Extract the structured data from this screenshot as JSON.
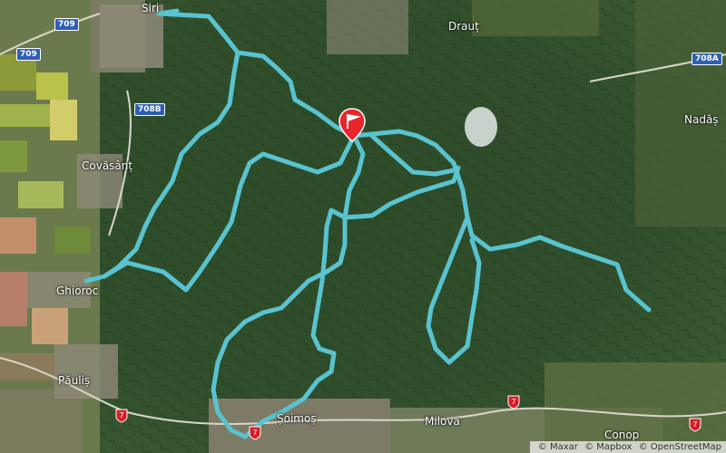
{
  "map": {
    "route_color": "#59c3cf",
    "marker_color": "#e8262b",
    "places": [
      {
        "id": "siria",
        "label": "Siri"
      },
      {
        "id": "draut",
        "label": "Drauț"
      },
      {
        "id": "nadas",
        "label": "Nadăș"
      },
      {
        "id": "covasant",
        "label": "Covăsânț"
      },
      {
        "id": "ghioroc",
        "label": "Ghioroc"
      },
      {
        "id": "paulis",
        "label": "Păuliș"
      },
      {
        "id": "soimos",
        "label": "Șoimoș"
      },
      {
        "id": "milova",
        "label": "Milova"
      },
      {
        "id": "conop",
        "label": "Conop"
      }
    ],
    "road_shields": [
      {
        "id": "r709-top",
        "label": "709"
      },
      {
        "id": "r709-left",
        "label": "709"
      },
      {
        "id": "r708b",
        "label": "708B"
      },
      {
        "id": "r708a",
        "label": "708A"
      }
    ],
    "route_shields": [
      {
        "id": "e7-left",
        "label": "7"
      },
      {
        "id": "e7-soimos",
        "label": "7"
      },
      {
        "id": "e7-center",
        "label": "7"
      },
      {
        "id": "e7-right",
        "label": "7"
      }
    ],
    "attribution": [
      "© Maxar",
      "© Mapbox",
      "© OpenStreetMap"
    ]
  }
}
